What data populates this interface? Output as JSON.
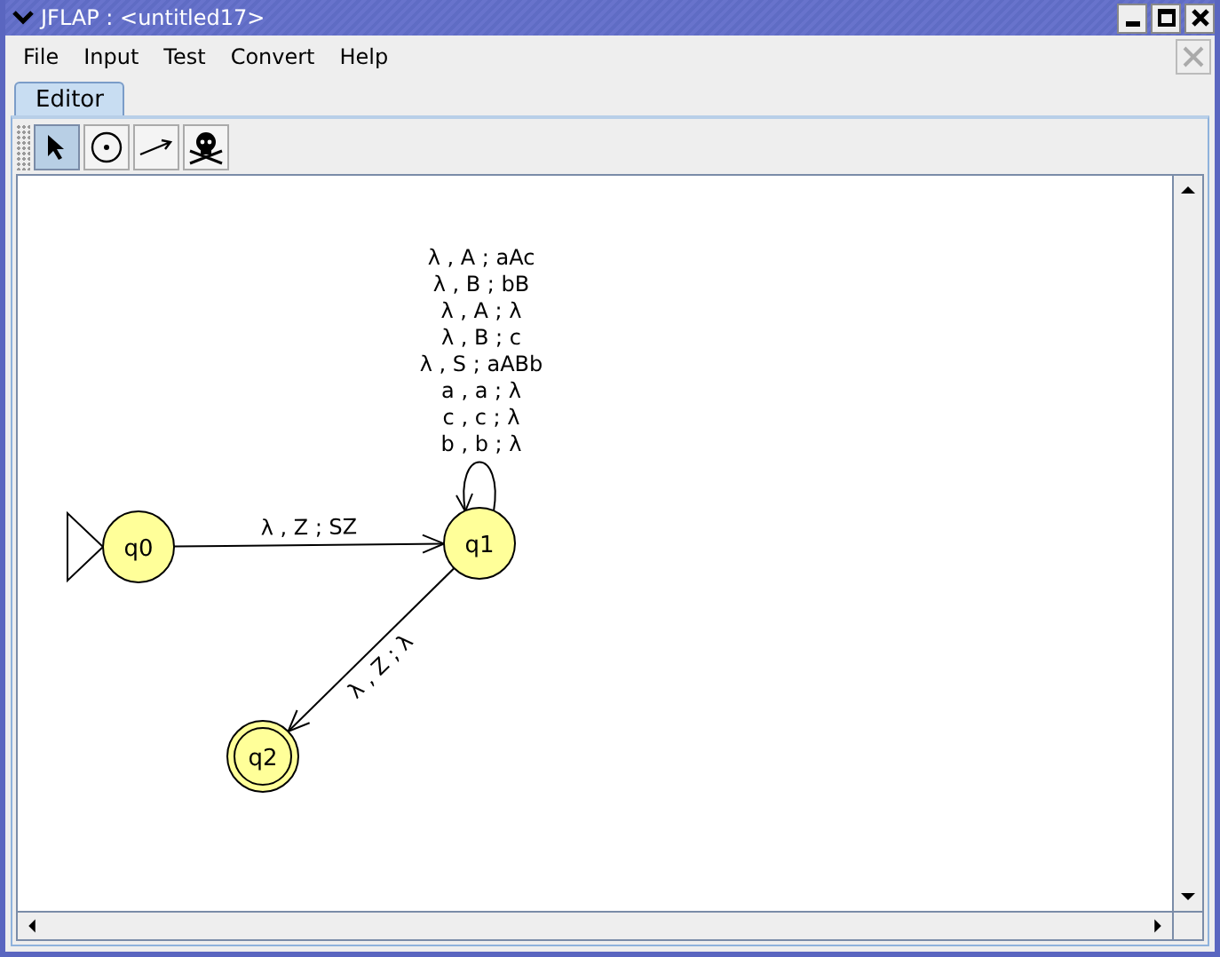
{
  "window": {
    "title": "JFLAP : <untitled17>"
  },
  "menu": [
    "File",
    "Input",
    "Test",
    "Convert",
    "Help"
  ],
  "tabs": [
    {
      "label": "Editor",
      "selected": true
    }
  ],
  "toolbar": [
    {
      "kind": "pointer",
      "selected": true
    },
    {
      "kind": "state",
      "selected": false
    },
    {
      "kind": "transition",
      "selected": false
    },
    {
      "kind": "delete",
      "selected": false
    }
  ],
  "states": [
    {
      "name": "q0",
      "initial": true,
      "final": false
    },
    {
      "name": "q1",
      "initial": false,
      "final": false
    },
    {
      "name": "q2",
      "initial": false,
      "final": true
    }
  ],
  "transitions": [
    {
      "labels": [
        "λ , Z ; SZ"
      ]
    },
    {
      "labels": [
        "λ , A ; aAc",
        "λ , B ; bB",
        "λ , A ; λ",
        "λ , B ; c",
        "λ , S ; aABb",
        "a , a ; λ",
        "c , c ; λ",
        "b , b ; λ"
      ]
    },
    {
      "labels": [
        "λ , Z ; λ"
      ]
    }
  ]
}
